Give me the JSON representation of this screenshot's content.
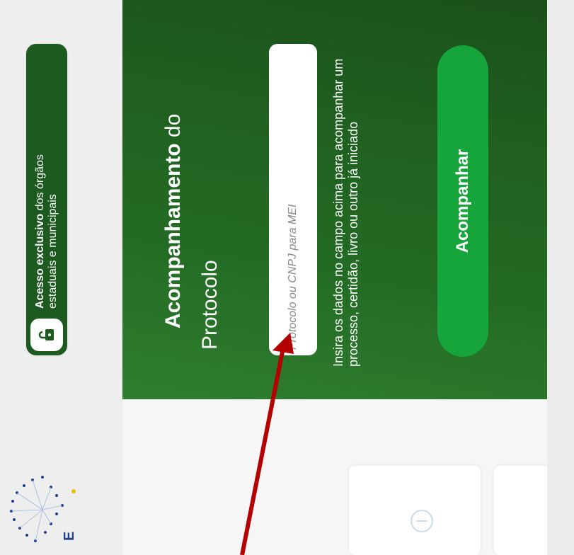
{
  "badge": {
    "bold_text": "Acesso exclusivo",
    "text_line1": " dos órgãos",
    "text_line2": "estaduais e municipais",
    "icon": "lock-icon"
  },
  "hero": {
    "title_bold": "Acompanhamento",
    "title_rest": " do",
    "subtitle": "Protocolo",
    "input_placeholder": "Protocolo ou CNPJ para MEI",
    "hint": "Insira os dados no campo acima para acompanhar um processo, certidão, livro ou outro já iniciado",
    "button_label": "Acompanhar"
  },
  "cards": [
    {
      "icon": "info-icon"
    },
    {
      "icon": "search-people-icon"
    }
  ],
  "logo": {
    "letter": "E"
  },
  "colors": {
    "hero_green": "#236b24",
    "button_green": "#16a53a",
    "arrow_red": "#b30000"
  }
}
